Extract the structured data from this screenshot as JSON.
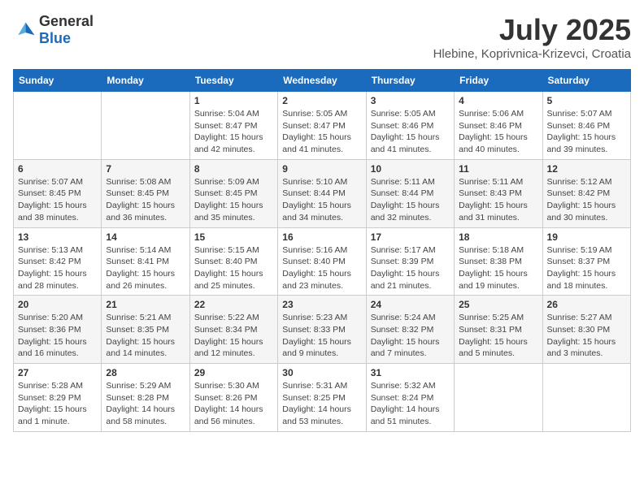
{
  "logo": {
    "general": "General",
    "blue": "Blue"
  },
  "title": "July 2025",
  "location": "Hlebine, Koprivnica-Krizevci, Croatia",
  "days_of_week": [
    "Sunday",
    "Monday",
    "Tuesday",
    "Wednesday",
    "Thursday",
    "Friday",
    "Saturday"
  ],
  "weeks": [
    [
      {
        "day": "",
        "info": ""
      },
      {
        "day": "",
        "info": ""
      },
      {
        "day": "1",
        "info": "Sunrise: 5:04 AM\nSunset: 8:47 PM\nDaylight: 15 hours and 42 minutes."
      },
      {
        "day": "2",
        "info": "Sunrise: 5:05 AM\nSunset: 8:47 PM\nDaylight: 15 hours and 41 minutes."
      },
      {
        "day": "3",
        "info": "Sunrise: 5:05 AM\nSunset: 8:46 PM\nDaylight: 15 hours and 41 minutes."
      },
      {
        "day": "4",
        "info": "Sunrise: 5:06 AM\nSunset: 8:46 PM\nDaylight: 15 hours and 40 minutes."
      },
      {
        "day": "5",
        "info": "Sunrise: 5:07 AM\nSunset: 8:46 PM\nDaylight: 15 hours and 39 minutes."
      }
    ],
    [
      {
        "day": "6",
        "info": "Sunrise: 5:07 AM\nSunset: 8:45 PM\nDaylight: 15 hours and 38 minutes."
      },
      {
        "day": "7",
        "info": "Sunrise: 5:08 AM\nSunset: 8:45 PM\nDaylight: 15 hours and 36 minutes."
      },
      {
        "day": "8",
        "info": "Sunrise: 5:09 AM\nSunset: 8:45 PM\nDaylight: 15 hours and 35 minutes."
      },
      {
        "day": "9",
        "info": "Sunrise: 5:10 AM\nSunset: 8:44 PM\nDaylight: 15 hours and 34 minutes."
      },
      {
        "day": "10",
        "info": "Sunrise: 5:11 AM\nSunset: 8:44 PM\nDaylight: 15 hours and 32 minutes."
      },
      {
        "day": "11",
        "info": "Sunrise: 5:11 AM\nSunset: 8:43 PM\nDaylight: 15 hours and 31 minutes."
      },
      {
        "day": "12",
        "info": "Sunrise: 5:12 AM\nSunset: 8:42 PM\nDaylight: 15 hours and 30 minutes."
      }
    ],
    [
      {
        "day": "13",
        "info": "Sunrise: 5:13 AM\nSunset: 8:42 PM\nDaylight: 15 hours and 28 minutes."
      },
      {
        "day": "14",
        "info": "Sunrise: 5:14 AM\nSunset: 8:41 PM\nDaylight: 15 hours and 26 minutes."
      },
      {
        "day": "15",
        "info": "Sunrise: 5:15 AM\nSunset: 8:40 PM\nDaylight: 15 hours and 25 minutes."
      },
      {
        "day": "16",
        "info": "Sunrise: 5:16 AM\nSunset: 8:40 PM\nDaylight: 15 hours and 23 minutes."
      },
      {
        "day": "17",
        "info": "Sunrise: 5:17 AM\nSunset: 8:39 PM\nDaylight: 15 hours and 21 minutes."
      },
      {
        "day": "18",
        "info": "Sunrise: 5:18 AM\nSunset: 8:38 PM\nDaylight: 15 hours and 19 minutes."
      },
      {
        "day": "19",
        "info": "Sunrise: 5:19 AM\nSunset: 8:37 PM\nDaylight: 15 hours and 18 minutes."
      }
    ],
    [
      {
        "day": "20",
        "info": "Sunrise: 5:20 AM\nSunset: 8:36 PM\nDaylight: 15 hours and 16 minutes."
      },
      {
        "day": "21",
        "info": "Sunrise: 5:21 AM\nSunset: 8:35 PM\nDaylight: 15 hours and 14 minutes."
      },
      {
        "day": "22",
        "info": "Sunrise: 5:22 AM\nSunset: 8:34 PM\nDaylight: 15 hours and 12 minutes."
      },
      {
        "day": "23",
        "info": "Sunrise: 5:23 AM\nSunset: 8:33 PM\nDaylight: 15 hours and 9 minutes."
      },
      {
        "day": "24",
        "info": "Sunrise: 5:24 AM\nSunset: 8:32 PM\nDaylight: 15 hours and 7 minutes."
      },
      {
        "day": "25",
        "info": "Sunrise: 5:25 AM\nSunset: 8:31 PM\nDaylight: 15 hours and 5 minutes."
      },
      {
        "day": "26",
        "info": "Sunrise: 5:27 AM\nSunset: 8:30 PM\nDaylight: 15 hours and 3 minutes."
      }
    ],
    [
      {
        "day": "27",
        "info": "Sunrise: 5:28 AM\nSunset: 8:29 PM\nDaylight: 15 hours and 1 minute."
      },
      {
        "day": "28",
        "info": "Sunrise: 5:29 AM\nSunset: 8:28 PM\nDaylight: 14 hours and 58 minutes."
      },
      {
        "day": "29",
        "info": "Sunrise: 5:30 AM\nSunset: 8:26 PM\nDaylight: 14 hours and 56 minutes."
      },
      {
        "day": "30",
        "info": "Sunrise: 5:31 AM\nSunset: 8:25 PM\nDaylight: 14 hours and 53 minutes."
      },
      {
        "day": "31",
        "info": "Sunrise: 5:32 AM\nSunset: 8:24 PM\nDaylight: 14 hours and 51 minutes."
      },
      {
        "day": "",
        "info": ""
      },
      {
        "day": "",
        "info": ""
      }
    ]
  ]
}
